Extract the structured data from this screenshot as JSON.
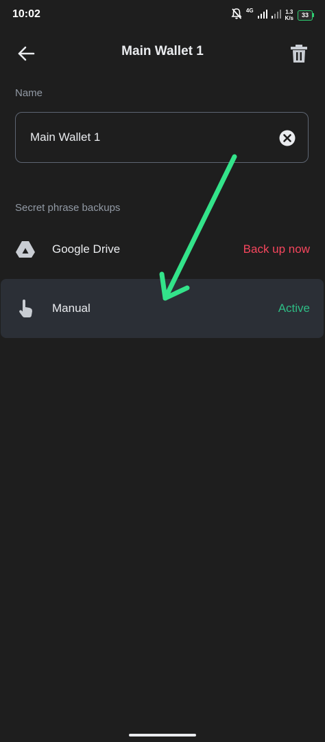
{
  "status_bar": {
    "time": "10:02",
    "network_type": "4G",
    "speed_value": "1.3",
    "speed_unit": "K/s",
    "battery_level": "33",
    "icons": [
      "notifications-off-icon",
      "signal-icon",
      "signal-icon-2",
      "battery-icon"
    ],
    "battery_color": "#2ecc71"
  },
  "header": {
    "title": "Main Wallet 1",
    "back_icon": "arrow-left-icon",
    "delete_icon": "trash-icon"
  },
  "name_section": {
    "label": "Name",
    "value": "Main Wallet 1",
    "clear_icon": "clear-icon"
  },
  "backups_section": {
    "label": "Secret phrase backups",
    "items": [
      {
        "label": "Google Drive",
        "status": "Back up now",
        "status_color": "#f6465d",
        "icon": "google-drive-icon"
      },
      {
        "label": "Manual",
        "status": "Active",
        "status_color": "#2ebd85",
        "icon": "hand-pointer-icon"
      }
    ]
  },
  "annotation": {
    "color": "#33e38a",
    "icon": "annotation-arrow"
  },
  "colors": {
    "background": "#1e1e1e",
    "highlight_row": "#2b2f36",
    "primary_text": "#eaecef",
    "secondary_text": "#929aa5"
  }
}
